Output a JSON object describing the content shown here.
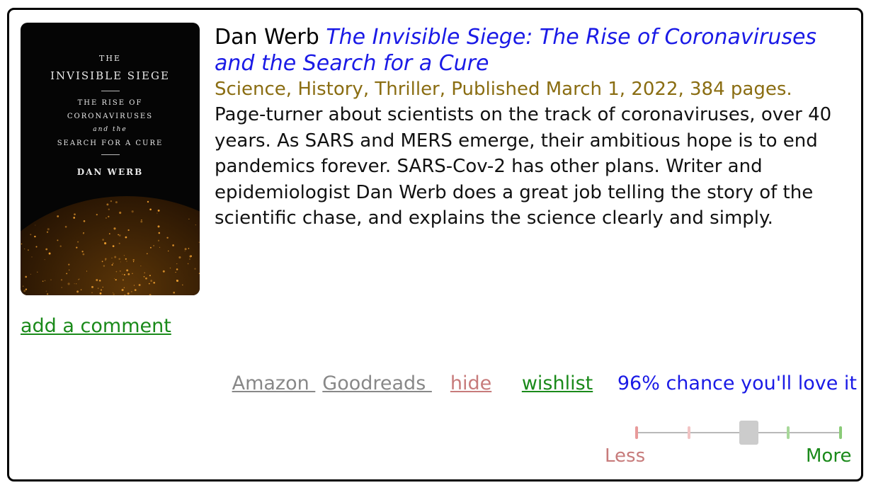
{
  "book": {
    "author": "Dan Werb",
    "title": "The Invisible Siege: The Rise of Coronaviruses and the Search for a Cure",
    "meta": "Science, History, Thriller, Published March 1, 2022, 384 pages.",
    "description": "Page-turner about scientists on the track of coronaviruses, over 40 years. As SARS and MERS emerge, their ambitious hope is to end pandemics forever. SARS-Cov-2 has other plans. Writer and epidemiologist Dan Werb does a great job telling the story of the scientific chase, and explains the science clearly and simply."
  },
  "cover": {
    "line1": "THE",
    "line2": "INVISIBLE SIEGE",
    "line3": "THE RISE OF",
    "line4": "CORONAVIRUSES",
    "line5": "and the",
    "line6": "SEARCH FOR A CURE",
    "line7": "DAN WERB"
  },
  "actions": {
    "comment": "add a comment",
    "amazon": " Amazon ",
    "goodreads": " Goodreads ",
    "hide": "hide",
    "wishlist": "wishlist",
    "chance": "96% chance you'll love it"
  },
  "rating": {
    "less_label": "Less",
    "more_label": "More",
    "position_fraction": 0.55
  },
  "colors": {
    "title_link": "#1a1ae6",
    "meta": "#8a6d12",
    "green": "#1a8a1a",
    "red": "#c77b7b",
    "gray": "#888888"
  }
}
